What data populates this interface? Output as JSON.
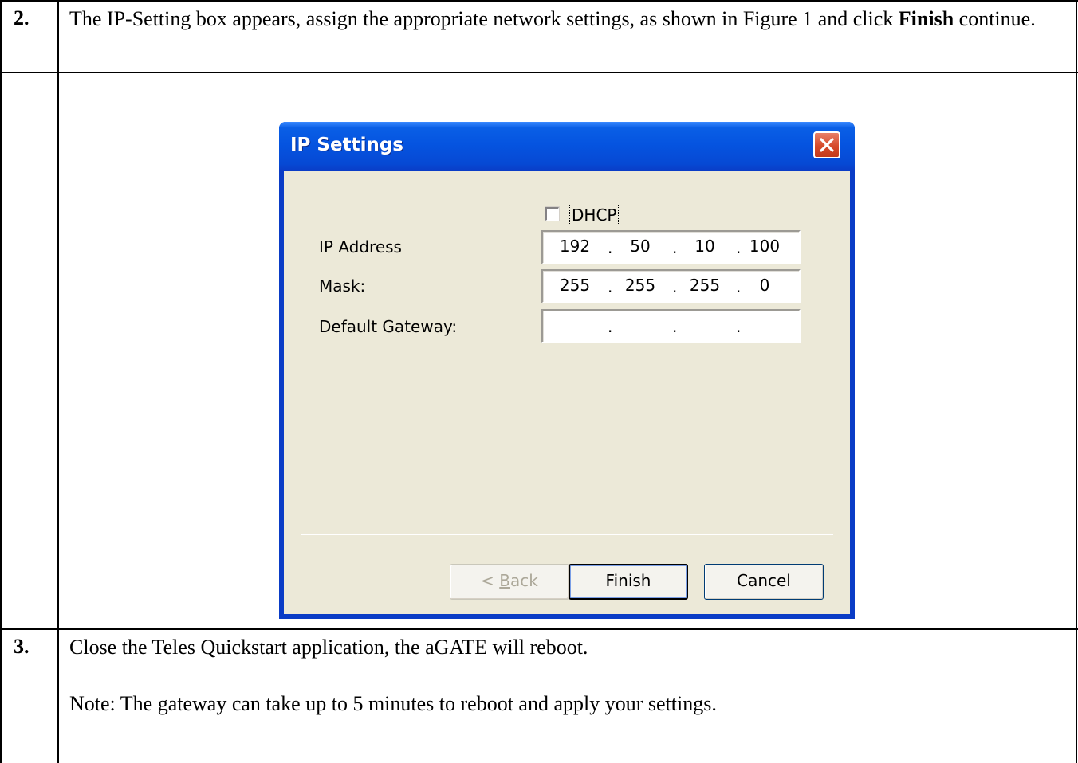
{
  "steps": [
    {
      "number": "2.",
      "text_before": "The IP-Setting box appears, assign the appropriate network settings, as shown in Figure 1 and click ",
      "bold_word": "Finish",
      "text_after": " continue."
    },
    {
      "number": "3.",
      "line1": "Close the Teles Quickstart application, the aGATE will reboot.",
      "line2": "Note: The gateway can take up to 5 minutes to reboot and apply your settings."
    }
  ],
  "dialog": {
    "title": "IP Settings",
    "dhcp": {
      "label": "DHCP",
      "checked": false
    },
    "fields": [
      {
        "label": "IP Address",
        "octets": [
          "192",
          "50",
          "10",
          "100"
        ]
      },
      {
        "label": "Mask:",
        "octets": [
          "255",
          "255",
          "255",
          "0"
        ]
      },
      {
        "label": "Default Gateway:",
        "octets": [
          "",
          "",
          "",
          ""
        ]
      }
    ],
    "buttons": {
      "back_prefix": "< ",
      "back_mnemonic": "B",
      "back_rest": "ack",
      "finish": "Finish",
      "cancel": "Cancel"
    },
    "colors": {
      "titlebar": "#0554e0",
      "client": "#ece9d8",
      "close": "#d64a2a"
    }
  }
}
